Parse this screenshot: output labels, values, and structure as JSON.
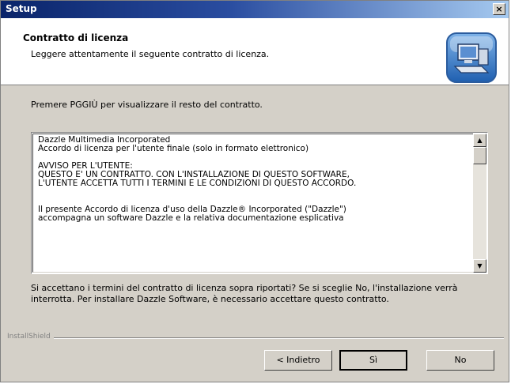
{
  "window": {
    "title": "Setup",
    "close_glyph": "×"
  },
  "header": {
    "title": "Contratto di licenza",
    "subtitle": "Leggere attentamente il seguente contratto di licenza.",
    "icon": "setup-computer-icon"
  },
  "intro": "Premere PGGIÙ per visualizzare il resto del contratto.",
  "license": {
    "text": "Dazzle Multimedia Incorporated\nAccordo di licenza per l'utente finale (solo in formato elettronico)\n\nAVVISO PER L'UTENTE:\nQUESTO E' UN CONTRATTO. CON L'INSTALLAZIONE DI QUESTO SOFTWARE,\nL'UTENTE ACCETTA TUTTI I TERMINI E LE CONDIZIONI DI QUESTO ACCORDO.\n\n\nIl presente Accordo di licenza d'uso della Dazzle® Incorporated (\"Dazzle\")\naccompagna un software Dazzle e la relativa documentazione esplicativa",
    "scroll_up": "▲",
    "scroll_down": "▼"
  },
  "question": "Si accettano i termini del contratto di licenza sopra riportati?  Se si sceglie No, l'installazione verrà interrotta.  Per installare Dazzle Software, è necessario accettare questo contratto.",
  "brand": "InstallShield",
  "buttons": {
    "back": "< Indietro",
    "yes": "Sì",
    "no": "No"
  },
  "colors": {
    "titlebar_start": "#0a246a",
    "titlebar_end": "#a6caf0",
    "face": "#d4d0c8"
  }
}
